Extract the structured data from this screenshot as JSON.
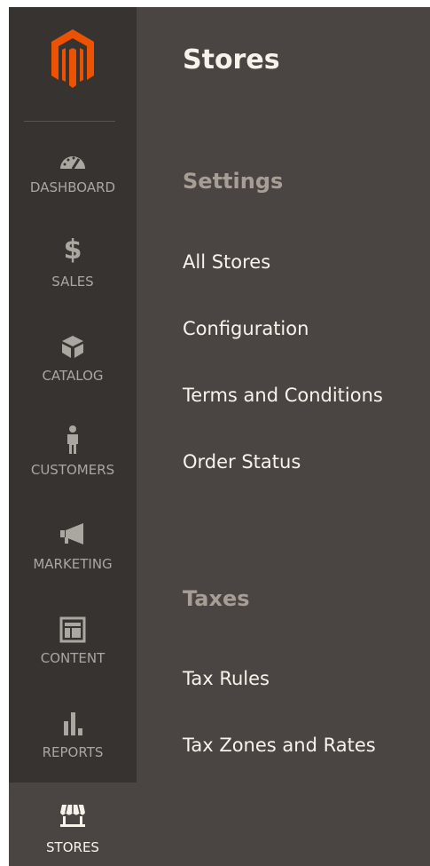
{
  "sidebar": {
    "items": [
      {
        "label": "DASHBOARD",
        "icon": "dashboard-icon"
      },
      {
        "label": "SALES",
        "icon": "dollar-icon"
      },
      {
        "label": "CATALOG",
        "icon": "cube-icon"
      },
      {
        "label": "CUSTOMERS",
        "icon": "person-icon"
      },
      {
        "label": "MARKETING",
        "icon": "megaphone-icon"
      },
      {
        "label": "CONTENT",
        "icon": "layout-icon"
      },
      {
        "label": "REPORTS",
        "icon": "bar-chart-icon"
      },
      {
        "label": "STORES",
        "icon": "storefront-icon",
        "active": true
      }
    ]
  },
  "submenu": {
    "title": "Stores",
    "sections": [
      {
        "title": "Settings",
        "links": [
          "All Stores",
          "Configuration",
          "Terms and Conditions",
          "Order Status"
        ]
      },
      {
        "title": "Taxes",
        "links": [
          "Tax Rules",
          "Tax Zones and Rates"
        ]
      }
    ]
  },
  "colors": {
    "sidebar_bg": "#373330",
    "panel_bg": "#4a4542",
    "brand_orange": "#eb5202",
    "text_light": "#f7f3eb",
    "text_muted": "#aaa6a0",
    "section_title": "#a79d95"
  }
}
